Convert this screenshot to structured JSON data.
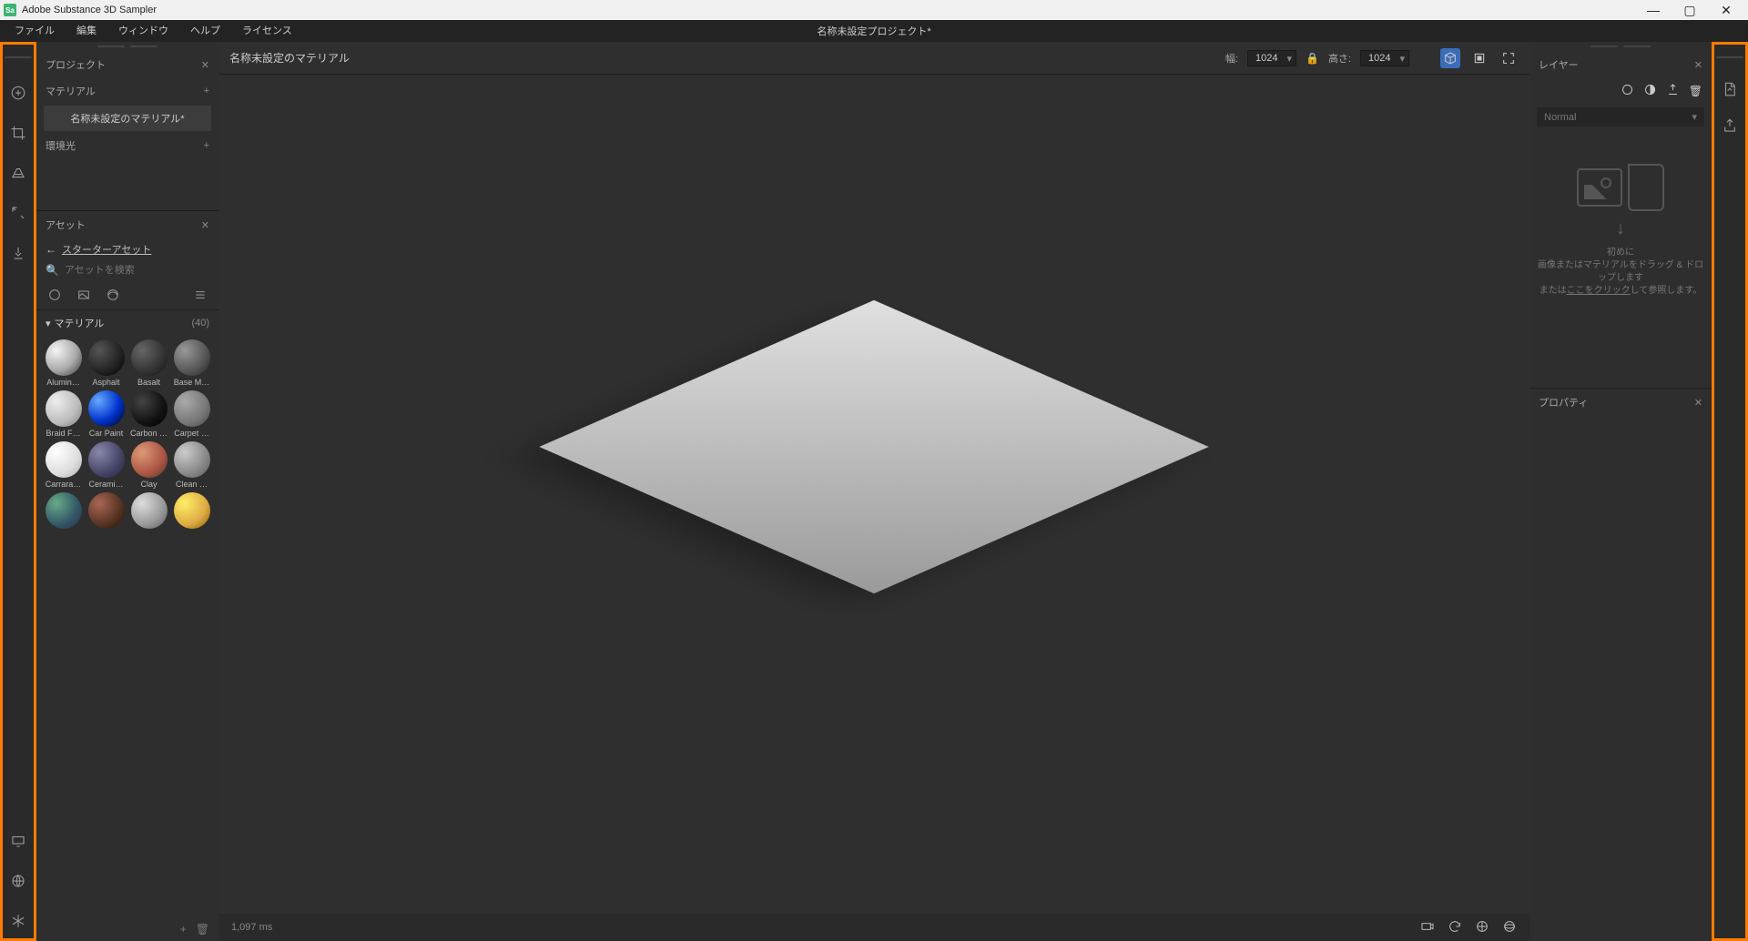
{
  "app": {
    "name": "Adobe Substance 3D Sampler",
    "icon_label": "Sa"
  },
  "window_buttons": {
    "min": "—",
    "max": "▢",
    "close": "✕"
  },
  "menu": {
    "file": "ファイル",
    "edit": "編集",
    "window": "ウィンドウ",
    "help": "ヘルプ",
    "license": "ライセンス",
    "doc_title": "名称未設定プロジェクト*"
  },
  "project_panel": {
    "title": "プロジェクト",
    "materials_section": "マテリアル",
    "material_item": "名称未設定のマテリアル*",
    "env_section": "環境光"
  },
  "assets_panel": {
    "title": "アセット",
    "back_link": "スターターアセット",
    "search_placeholder": "アセットを検索",
    "category": "マテリアル",
    "count": "(40)",
    "thumbs": [
      {
        "name": "Alumin…",
        "grad": "radial-gradient(circle at 30% 30%,#f5f5f5,#aaa 55%,#333)"
      },
      {
        "name": "Asphalt",
        "grad": "radial-gradient(circle at 30% 30%,#555,#222 60%,#000)"
      },
      {
        "name": "Basalt",
        "grad": "radial-gradient(circle at 30% 30%,#666,#333 60%,#111)"
      },
      {
        "name": "Base M…",
        "grad": "radial-gradient(circle at 30% 30%,#999,#555 60%,#222)"
      },
      {
        "name": "Braid F…",
        "grad": "radial-gradient(circle at 30% 30%,#eee,#bbb 60%,#777)"
      },
      {
        "name": "Car Paint",
        "grad": "radial-gradient(circle at 28% 28%,#6af,#03c 55%,#001)"
      },
      {
        "name": "Carbon …",
        "grad": "radial-gradient(circle at 30% 30%,#444,#111 60%,#000)"
      },
      {
        "name": "Carpet …",
        "grad": "radial-gradient(circle at 30% 30%,#aaa,#777 60%,#444)"
      },
      {
        "name": "Carrara…",
        "grad": "radial-gradient(circle at 30% 30%,#fff,#ddd 60%,#aaa)"
      },
      {
        "name": "Cerami…",
        "grad": "radial-gradient(circle at 30% 30%,#88a,#446 60%,#224)"
      },
      {
        "name": "Clay",
        "grad": "radial-gradient(circle at 30% 30%,#d97,#a54 60%,#532)"
      },
      {
        "name": "Clean …",
        "grad": "radial-gradient(circle at 30% 30%,#ccc,#888 60%,#555)"
      },
      {
        "name": "",
        "grad": "radial-gradient(circle at 30% 30%,#6a8,#356 60%,#234)"
      },
      {
        "name": "",
        "grad": "radial-gradient(circle at 30% 30%,#a65,#532 60%,#210)"
      },
      {
        "name": "",
        "grad": "radial-gradient(circle at 30% 30%,#ddd,#999 60%,#555)"
      },
      {
        "name": "",
        "grad": "radial-gradient(circle at 30% 30%,#fe6,#da4 60%,#850)"
      }
    ]
  },
  "viewport": {
    "title": "名称未設定のマテリアル",
    "width_label": "幅:",
    "width_value": "1024",
    "height_label": "高さ:",
    "height_value": "1024",
    "render_time": "1,097 ms"
  },
  "layers_panel": {
    "title": "レイヤー",
    "blend_mode": "Normal",
    "hint_title": "初めに",
    "hint_line1": "画像またはマテリアルをドラッグ & ドロップします",
    "hint_line2_a": "または",
    "hint_line2_link": "ここをクリック",
    "hint_line2_b": "して参照します。"
  },
  "props_panel": {
    "title": "プロパティ"
  }
}
